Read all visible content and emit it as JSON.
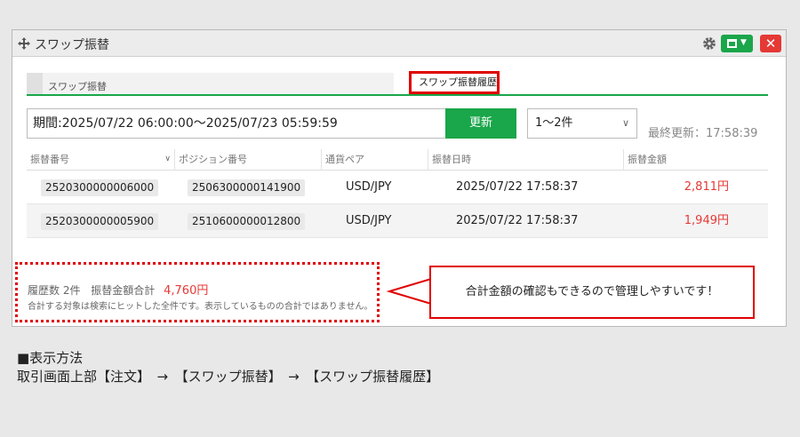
{
  "window": {
    "title": "スワップ振替"
  },
  "tabs": [
    {
      "label": "スワップ振替"
    },
    {
      "label": "スワップ振替履歴"
    }
  ],
  "filter": {
    "period_label": "期間:",
    "period_value": "2025/07/22 06:00:00〜2025/07/23 05:59:59",
    "update_label": "更新",
    "range_selected": "1〜2件",
    "last_update": "最終更新：17:58:39"
  },
  "table": {
    "columns": [
      "振替番号",
      "ポジション番号",
      "通貨ペア",
      "振替日時",
      "振替金額"
    ],
    "rows": [
      {
        "transfer_no": "2520300000006000",
        "position_no": "2506300000141900",
        "pair": "USD/JPY",
        "datetime": "2025/07/22 17:58:37",
        "amount": "2,811円"
      },
      {
        "transfer_no": "2520300000005900",
        "position_no": "2510600000012800",
        "pair": "USD/JPY",
        "datetime": "2025/07/22 17:58:37",
        "amount": "1,949円"
      }
    ]
  },
  "summary": {
    "count_label": "履歴数 2件",
    "total_label": "振替金額合計",
    "total_value": "4,760円",
    "note": "合計する対象は検索にヒットした全件です。表示しているものの合計ではありません。"
  },
  "callout": "合計金額の確認もできるので管理しやすいです！",
  "footer": {
    "heading": "■表示方法",
    "path": "取引画面上部【注文】　→　【スワップ振替】　→　【スワップ振替履歴】"
  },
  "colors": {
    "accent_green": "#1aa64a",
    "highlight_red": "#e00000",
    "amount_red": "#e53935"
  }
}
